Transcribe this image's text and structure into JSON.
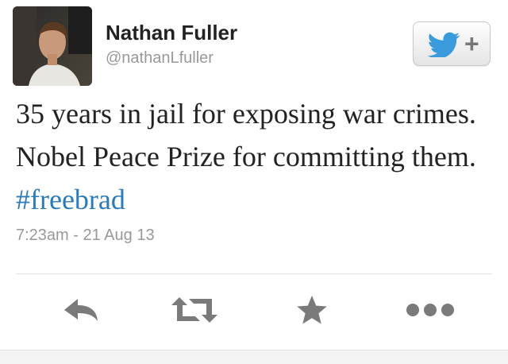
{
  "tweet": {
    "author": {
      "name": "Nathan Fuller",
      "handle": "@nathanLfuller",
      "avatar_icon": "profile-photo"
    },
    "follow_button": {
      "icon": "twitter-bird-icon",
      "plus_label": "+"
    },
    "text_plain": "35 years in jail for exposing war crimes. Nobel Peace Prize for committing them. ",
    "hashtag": "#freebrad",
    "timestamp": "7:23am - 21 Aug 13",
    "actions": [
      {
        "name": "reply",
        "icon": "reply-arrow-icon"
      },
      {
        "name": "retweet",
        "icon": "retweet-icon"
      },
      {
        "name": "favorite",
        "icon": "star-icon"
      },
      {
        "name": "more",
        "icon": "more-dots-icon"
      }
    ]
  },
  "colors": {
    "link": "#2b7bb9",
    "bird": "#3a9bdc",
    "icon_gray": "#7a7a7a",
    "secondary_text": "#999999"
  }
}
